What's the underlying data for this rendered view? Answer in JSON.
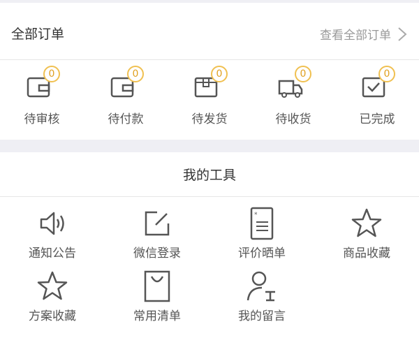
{
  "orders": {
    "title": "全部订单",
    "view_all": "查看全部订单",
    "items": [
      {
        "label": "待审核",
        "count": "0",
        "icon": "pending-review-icon"
      },
      {
        "label": "待付款",
        "count": "0",
        "icon": "wallet-icon"
      },
      {
        "label": "待发货",
        "count": "0",
        "icon": "package-icon"
      },
      {
        "label": "待收货",
        "count": "0",
        "icon": "truck-icon"
      },
      {
        "label": "已完成",
        "count": "0",
        "icon": "check-box-icon"
      }
    ]
  },
  "tools": {
    "title": "我的工具",
    "items": [
      {
        "label": "通知公告",
        "icon": "speaker-icon"
      },
      {
        "label": "微信登录",
        "icon": "edit-icon"
      },
      {
        "label": "评价晒单",
        "icon": "document-icon"
      },
      {
        "label": "商品收藏",
        "icon": "star-icon"
      },
      {
        "label": "方案收藏",
        "icon": "star-icon"
      },
      {
        "label": "常用清单",
        "icon": "shopping-bag-icon"
      },
      {
        "label": "我的留言",
        "icon": "user-message-icon"
      }
    ]
  },
  "colors": {
    "badge": "#f0c050",
    "icon_stroke": "#555555",
    "secondary_text": "#999999"
  }
}
